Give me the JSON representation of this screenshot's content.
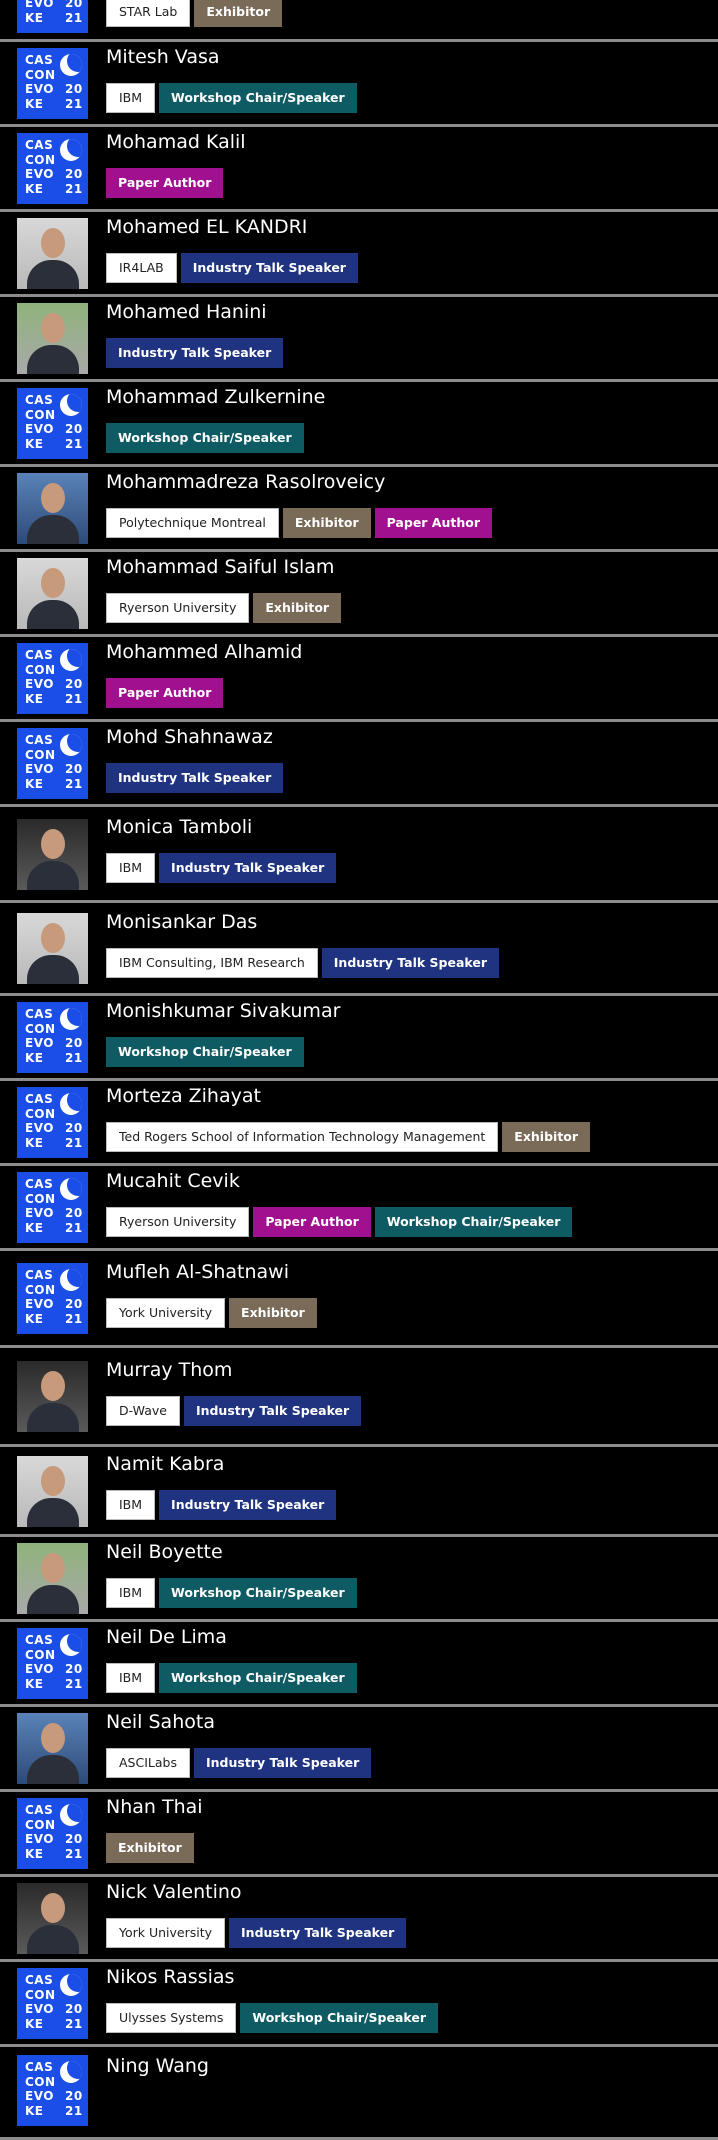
{
  "logo": {
    "line1": "CAS",
    "line2": "CON",
    "line3": "EVO",
    "line4": "KE",
    "year1": "20",
    "year2": "21"
  },
  "colors": {
    "background": "#000000",
    "divider": "#8c8c8c",
    "logo_blue": "#1b4ee6",
    "Exhibitor": "#7a6a58",
    "Workshop Chair/Speaker": "#0f5b63",
    "Paper Author": "#a0108f",
    "Industry Talk Speaker": "#1f3380"
  },
  "people": [
    {
      "name": "",
      "image": "logo",
      "tags": [
        {
          "label": "STAR Lab",
          "kind": "org"
        },
        {
          "label": "Exhibitor",
          "kind": "exhibitor"
        }
      ]
    },
    {
      "name": "Mitesh Vasa",
      "image": "logo",
      "tags": [
        {
          "label": "IBM",
          "kind": "org"
        },
        {
          "label": "Workshop Chair/Speaker",
          "kind": "workshop"
        }
      ]
    },
    {
      "name": "Mohamad Kalil",
      "image": "logo",
      "tags": [
        {
          "label": "Paper Author",
          "kind": "paper"
        }
      ]
    },
    {
      "name": "Mohamed EL KANDRI",
      "image": "photo",
      "tags": [
        {
          "label": "IR4LAB",
          "kind": "org"
        },
        {
          "label": "Industry Talk Speaker",
          "kind": "industry"
        }
      ]
    },
    {
      "name": "Mohamed Hanini",
      "image": "photo",
      "tags": [
        {
          "label": "Industry Talk Speaker",
          "kind": "industry"
        }
      ]
    },
    {
      "name": "Mohammad Zulkernine",
      "image": "logo",
      "tags": [
        {
          "label": "Workshop Chair/Speaker",
          "kind": "workshop"
        }
      ]
    },
    {
      "name": "Mohammadreza Rasolroveicy",
      "image": "photo",
      "tags": [
        {
          "label": "Polytechnique Montreal",
          "kind": "org"
        },
        {
          "label": "Exhibitor",
          "kind": "exhibitor"
        },
        {
          "label": "Paper Author",
          "kind": "paper"
        }
      ]
    },
    {
      "name": "Mohammad Saiful Islam",
      "image": "photo",
      "tags": [
        {
          "label": "Ryerson University",
          "kind": "org"
        },
        {
          "label": "Exhibitor",
          "kind": "exhibitor"
        }
      ]
    },
    {
      "name": "Mohammed Alhamid",
      "image": "logo",
      "tags": [
        {
          "label": "Paper Author",
          "kind": "paper"
        }
      ]
    },
    {
      "name": "Mohd Shahnawaz",
      "image": "logo",
      "tags": [
        {
          "label": "Industry Talk Speaker",
          "kind": "industry"
        }
      ]
    },
    {
      "name": "Monica Tamboli",
      "image": "photo",
      "tags": [
        {
          "label": "IBM",
          "kind": "org"
        },
        {
          "label": "Industry Talk Speaker",
          "kind": "industry"
        }
      ]
    },
    {
      "name": "Monisankar Das",
      "image": "photo",
      "tags": [
        {
          "label": "IBM Consulting, IBM Research",
          "kind": "org"
        },
        {
          "label": "Industry Talk Speaker",
          "kind": "industry"
        }
      ]
    },
    {
      "name": "Monishkumar Sivakumar",
      "image": "logo",
      "tags": [
        {
          "label": "Workshop Chair/Speaker",
          "kind": "workshop"
        }
      ]
    },
    {
      "name": "Morteza Zihayat",
      "image": "logo",
      "tags": [
        {
          "label": "Ted Rogers School of Information Technology Management",
          "kind": "org"
        },
        {
          "label": "Exhibitor",
          "kind": "exhibitor"
        }
      ]
    },
    {
      "name": "Mucahit Cevik",
      "image": "logo",
      "tags": [
        {
          "label": "Ryerson University",
          "kind": "org"
        },
        {
          "label": "Paper Author",
          "kind": "paper"
        },
        {
          "label": "Workshop Chair/Speaker",
          "kind": "workshop"
        }
      ]
    },
    {
      "name": "Mufleh Al-Shatnawi",
      "image": "logo",
      "tags": [
        {
          "label": "York University",
          "kind": "org"
        },
        {
          "label": "Exhibitor",
          "kind": "exhibitor"
        }
      ]
    },
    {
      "name": "Murray Thom",
      "image": "photo",
      "tags": [
        {
          "label": "D-Wave",
          "kind": "org"
        },
        {
          "label": "Industry Talk Speaker",
          "kind": "industry"
        }
      ]
    },
    {
      "name": "Namit Kabra",
      "image": "photo",
      "tags": [
        {
          "label": "IBM",
          "kind": "org"
        },
        {
          "label": "Industry Talk Speaker",
          "kind": "industry"
        }
      ]
    },
    {
      "name": "Neil Boyette",
      "image": "photo",
      "tags": [
        {
          "label": "IBM",
          "kind": "org"
        },
        {
          "label": "Workshop Chair/Speaker",
          "kind": "workshop"
        }
      ]
    },
    {
      "name": "Neil De Lima",
      "image": "logo",
      "tags": [
        {
          "label": "IBM",
          "kind": "org"
        },
        {
          "label": "Workshop Chair/Speaker",
          "kind": "workshop"
        }
      ]
    },
    {
      "name": "Neil Sahota",
      "image": "photo",
      "tags": [
        {
          "label": "ASCILabs",
          "kind": "org"
        },
        {
          "label": "Industry Talk Speaker",
          "kind": "industry"
        }
      ]
    },
    {
      "name": "Nhan Thai",
      "image": "logo",
      "tags": [
        {
          "label": "Exhibitor",
          "kind": "exhibitor"
        }
      ]
    },
    {
      "name": "Nick Valentino",
      "image": "photo",
      "tags": [
        {
          "label": "York University",
          "kind": "org"
        },
        {
          "label": "Industry Talk Speaker",
          "kind": "industry"
        }
      ]
    },
    {
      "name": "Nikos Rassias",
      "image": "logo",
      "tags": [
        {
          "label": "Ulysses Systems",
          "kind": "org"
        },
        {
          "label": "Workshop Chair/Speaker",
          "kind": "workshop"
        }
      ]
    },
    {
      "name": "Ning Wang",
      "image": "logo",
      "tags": []
    }
  ]
}
